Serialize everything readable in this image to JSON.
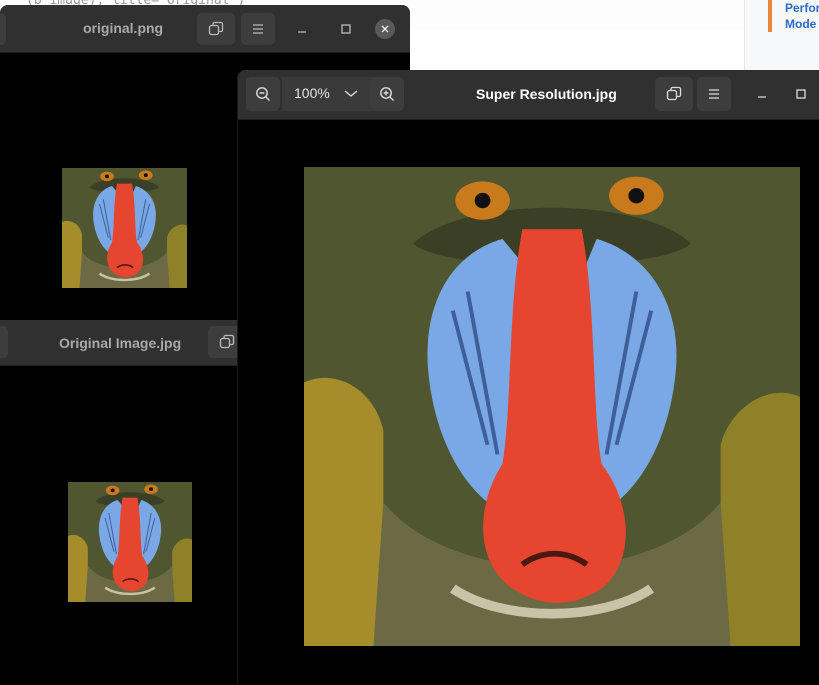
{
  "background": {
    "code_snippet": "(b_image), title=\"Original\")",
    "doc_links": [
      "Perfor",
      "Mode"
    ],
    "accent_color": "#e8883b",
    "link_color": "#2b6cc4"
  },
  "windows": {
    "original_png": {
      "title": "original.png",
      "icons": [
        "restore-icon",
        "menu-icon",
        "minimize-icon",
        "maximize-icon",
        "close-icon"
      ]
    },
    "original_image": {
      "title": "Original Image.jpg",
      "icons": [
        "restore-icon"
      ]
    },
    "super_resolution": {
      "title": "Super Resolution.jpg",
      "zoom": "100%",
      "icons": [
        "zoom-out-icon",
        "chevron-down-icon",
        "zoom-in-icon",
        "restore-icon",
        "menu-icon",
        "minimize-icon",
        "maximize-icon"
      ]
    }
  },
  "colors": {
    "titlebar": "#303030",
    "button": "#3d3d3d",
    "canvas": "#000000",
    "active_title": "#ffffff",
    "inactive_title": "#a9a9a9"
  }
}
